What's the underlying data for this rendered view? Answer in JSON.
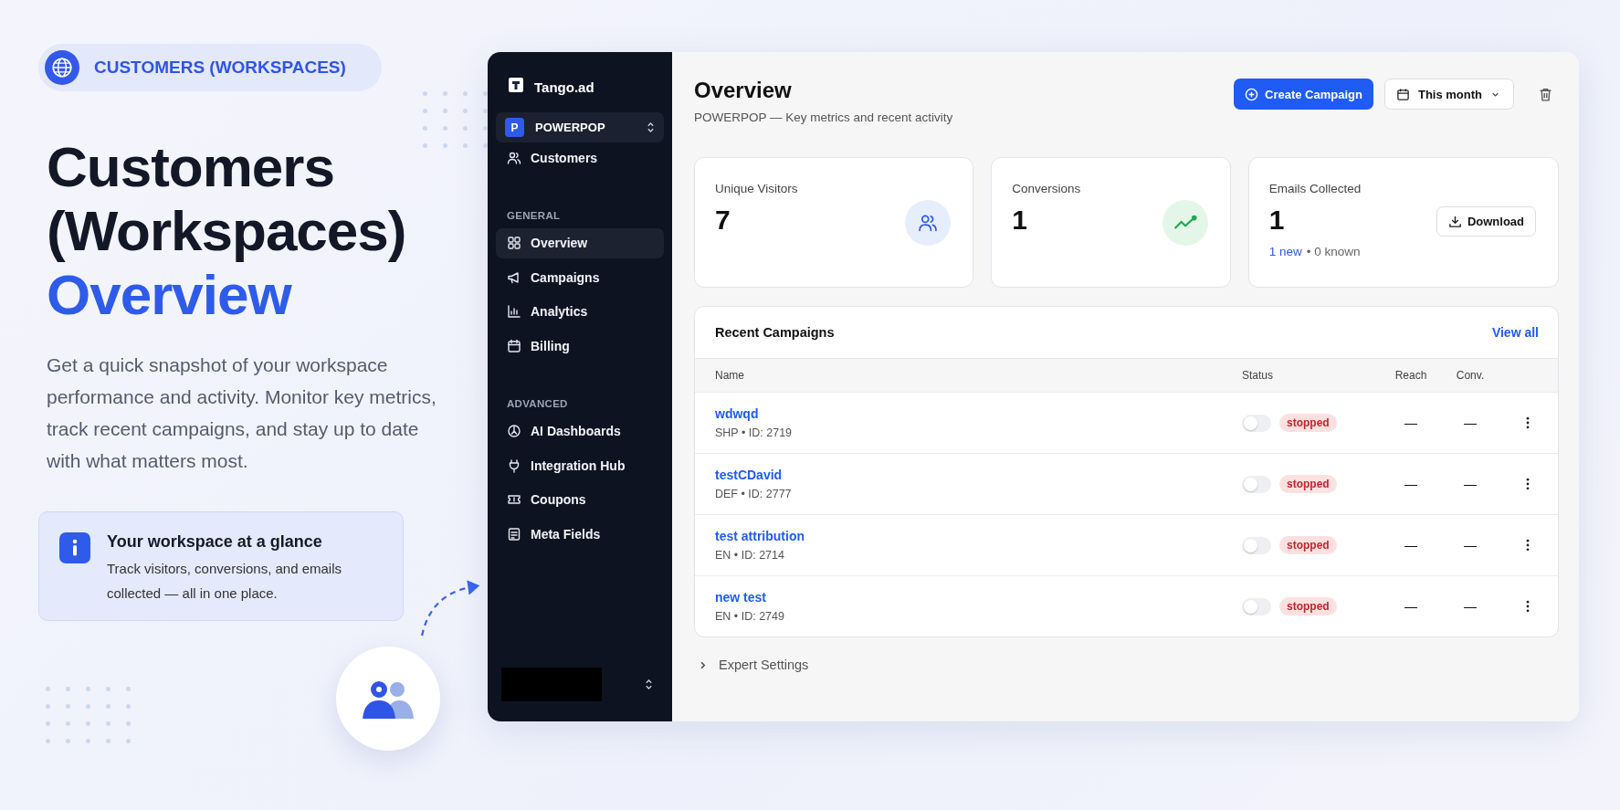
{
  "hero": {
    "badge": "CUSTOMERS (WORKSPACES)",
    "title_lines": [
      "Customers",
      "(Workspaces)"
    ],
    "title_accent": "Overview",
    "description": "Get a quick snapshot of your workspace performance and activity. Monitor key metrics, track recent campaigns, and stay up to date with what matters most.",
    "info": {
      "title": "Your workspace at a glance",
      "text": "Track visitors, conversions, and emails collected — all in one place."
    }
  },
  "sidebar": {
    "brand": "Tango.ad",
    "workspace": {
      "initial": "P",
      "name": "POWERPOP"
    },
    "sections": [
      {
        "items": [
          {
            "label": "Customers",
            "kind": "users",
            "selected": false
          }
        ]
      },
      {
        "heading": "GENERAL",
        "items": [
          {
            "label": "Overview",
            "kind": "grid",
            "selected": true
          },
          {
            "label": "Campaigns",
            "kind": "megaphone",
            "selected": false
          },
          {
            "label": "Analytics",
            "kind": "chart",
            "selected": false
          },
          {
            "label": "Billing",
            "kind": "calendar",
            "selected": false
          }
        ]
      },
      {
        "heading": "ADVANCED",
        "items": [
          {
            "label": "AI Dashboards",
            "kind": "gauge",
            "selected": false
          },
          {
            "label": "Integration Hub",
            "kind": "plug",
            "selected": false
          },
          {
            "label": "Coupons",
            "kind": "ticket",
            "selected": false
          },
          {
            "label": "Meta Fields",
            "kind": "form",
            "selected": false
          }
        ]
      }
    ]
  },
  "header": {
    "title": "Overview",
    "subtitle": "POWERPOP — Key metrics and recent activity",
    "create_button": "Create Campaign",
    "period": "This month"
  },
  "stats": [
    {
      "kind": "visitors",
      "label": "Unique Visitors",
      "value": "7"
    },
    {
      "kind": "conversions",
      "label": "Conversions",
      "value": "1"
    },
    {
      "kind": "emails",
      "label": "Emails Collected",
      "value": "1",
      "button": "Download",
      "new_text": "1 new",
      "known_text": "• 0 known"
    }
  ],
  "campaigns": {
    "title": "Recent Campaigns",
    "view_all": "View all",
    "columns": [
      "Name",
      "Status",
      "Reach",
      "Conv."
    ],
    "rows": [
      {
        "name": "wdwqd",
        "meta": "SHP • ID: 2719",
        "on": false,
        "status": "stopped",
        "reach": "—",
        "conv": "—"
      },
      {
        "name": "testCDavid",
        "meta": "DEF • ID: 2777",
        "on": false,
        "status": "stopped",
        "reach": "—",
        "conv": "—"
      },
      {
        "name": "test attribution",
        "meta": "EN • ID: 2714",
        "on": false,
        "status": "stopped",
        "reach": "—",
        "conv": "—"
      },
      {
        "name": "new test",
        "meta": "EN • ID: 2749",
        "on": false,
        "status": "stopped",
        "reach": "—",
        "conv": "—"
      }
    ]
  },
  "expert_settings": {
    "label": "Expert Settings",
    "expanded": false
  }
}
